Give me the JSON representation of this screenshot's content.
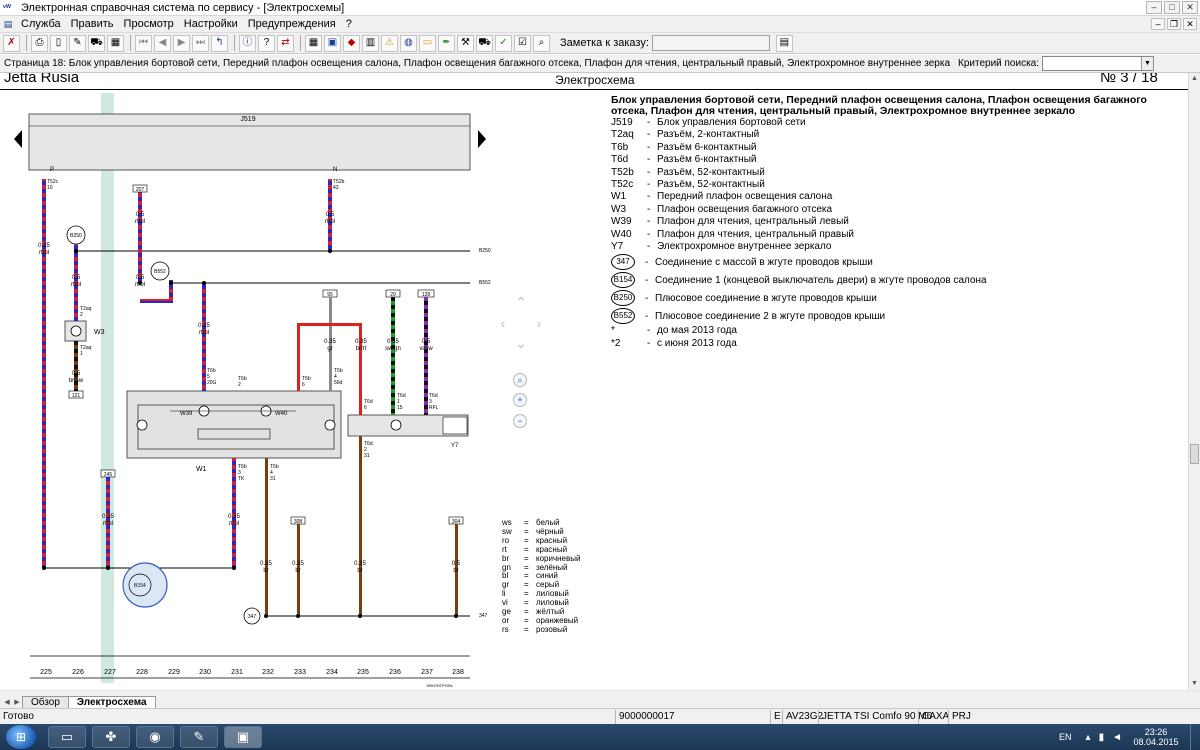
{
  "window": {
    "title": "Электронная справочная система по сервису - [Электросхемы]",
    "app_icon": "app-logo-icon"
  },
  "menu": [
    "Служба",
    "Править",
    "Просмотр",
    "Настройки",
    "Предупреждения",
    "?"
  ],
  "toolbar": {
    "order_label": "Заметка к заказу:",
    "order_value": ""
  },
  "infobar": {
    "text": "Страница 18: Блок управления бортовой сети, Передний плафон освещения салона, Плафон освещения багажного отсека, Плафон для чтения, центральный правый, Электрохромное внутреннее зеркало",
    "search_label": "Критерий поиска:",
    "search_value": ""
  },
  "document": {
    "model": "Jetta Rusia",
    "doc_type": "Электросхема",
    "page_no": "№  3 / 18",
    "legend_title": "Блок управления бортовой сети, Передний плафон освещения салона, Плафон освещения багажного отсека, Плафон для чтения, центральный правый, Электрохромное внутреннее зеркало",
    "legend": [
      {
        "code": "J519",
        "desc": "Блок управления бортовой сети"
      },
      {
        "code": "T2aq",
        "desc": "Разъём, 2-контактный"
      },
      {
        "code": "T6b",
        "desc": "Разъём 6-контактный"
      },
      {
        "code": "T6d",
        "desc": "Разъём 6-контактный"
      },
      {
        "code": "T52b",
        "desc": "Разъём, 52-контактный"
      },
      {
        "code": "T52c",
        "desc": "Разъём, 52-контактный"
      },
      {
        "code": "W1",
        "desc": "Передний плафон освещения салона"
      },
      {
        "code": "W3",
        "desc": "Плафон освещения багажного отсека"
      },
      {
        "code": "W39",
        "desc": "Плафон для чтения, центральный левый"
      },
      {
        "code": "W40",
        "desc": "Плафон для чтения, центральный правый"
      },
      {
        "code": "Y7",
        "desc": "Электрохромное внутреннее зеркало"
      }
    ],
    "legend_circles": [
      {
        "code": "347",
        "desc": "Соединение с массой в жгуте проводов крыши"
      },
      {
        "code": "B154",
        "desc": "Соединение 1 (концевой выключатель двери) в жгуте проводов салона"
      },
      {
        "code": "B250",
        "desc": "Плюсовое соединение в жгуте проводов крыши"
      },
      {
        "code": "B552",
        "desc": "Плюсовое соединение 2 в жгуте проводов крыши"
      }
    ],
    "legend_notes": [
      {
        "code": "*",
        "desc": "до мая 2013 года"
      },
      {
        "code": "*2",
        "desc": "с июня 2013 года"
      }
    ],
    "color_codes": [
      {
        "code": "ws",
        "name": "белый"
      },
      {
        "code": "sw",
        "name": "чёрный"
      },
      {
        "code": "ro",
        "name": "красный"
      },
      {
        "code": "rt",
        "name": "красный"
      },
      {
        "code": "br",
        "name": "коричневый"
      },
      {
        "code": "gn",
        "name": "зелёный"
      },
      {
        "code": "bl",
        "name": "синий"
      },
      {
        "code": "gr",
        "name": "серый"
      },
      {
        "code": "li",
        "name": "лиловый"
      },
      {
        "code": "vi",
        "name": "лиловый"
      },
      {
        "code": "ge",
        "name": "жёлтый"
      },
      {
        "code": "or",
        "name": "оранжевый"
      },
      {
        "code": "rs",
        "name": "розовый"
      }
    ],
    "diagram": {
      "j519_label": "J519",
      "w3_label": "W3",
      "w1_label": "W1",
      "w39_label": "W39",
      "w40_label": "W40",
      "y7_label": "Y7",
      "b250_label": "B250",
      "b552_label": "B552",
      "b154_label": "B154",
      "gnd_label": "347",
      "pin_p": "P",
      "pin_n": "N",
      "pin_t52c": "T52c",
      "pin_t52c_no": "10",
      "pin_t52b": "T52b",
      "pin_t52b_no": "43",
      "pin_t2aq_top": "T2aq",
      "pin_t2aq_top_no": "2",
      "pin_t2aq_bot": "T2aq",
      "pin_t2aq_bot_no": "1",
      "pin_t6b_1": "T6b",
      "pin_t6b_1_no": "5",
      "pin_t6b_1_star": "20G",
      "pin_t6b_2": "T6b",
      "pin_t6b_2_no": "2",
      "pin_t6b_3": "T6b",
      "pin_t6b_3_no": "6",
      "pin_t6b_4": "T6b",
      "pin_t6b_4_no": "4",
      "pin_t6b_4_star": "56d",
      "pin_t6b_5": "T6b",
      "pin_t6b_5_no": "3",
      "pin_t6b_5_star": "TK",
      "pin_t6b_6": "T6b",
      "pin_t6b_6_no": "4",
      "pin_t6b_6_star": "31",
      "pin_t6d_1": "T6d",
      "pin_t6d_1_no": "6",
      "pin_t6d_2": "T6d",
      "pin_t6d_2_no": "1",
      "pin_t6d_2_star": "15",
      "pin_t6d_3": "T6d",
      "pin_t6d_3_no": "3",
      "pin_t6d_3_star": "RFL",
      "pin_t6d_4": "T6d",
      "pin_t6d_4_no": "2",
      "pin_t6d_4_star": "31",
      "ref_207": "207",
      "ref_95": "95",
      "ref_29": "29",
      "ref_128": "128",
      "ref_121": "121",
      "ref_245": "245",
      "ref_308": "308",
      "ref_304": "304",
      "w_t52c": "0.35",
      "w_t52c_c": "rt/bl",
      "w_207": "0.5",
      "w_207_c": "rt/bl",
      "w_t52b": "0.5",
      "w_t52b_c": "rt/bl",
      "w_b250": "0.5",
      "w_b250_c": "rt/bl",
      "w_b552": "0.5",
      "w_b552_c": "rt/bl",
      "w_t6b5": "0.35",
      "w_t6b5_c": "rt/bl",
      "w_95": "0.35",
      "w_95_c": "gr",
      "w_red": "0.35",
      "w_red_c": "br/rt",
      "w_29": "0.35",
      "w_29_c": "sw/gn",
      "w_128": "0.5",
      "w_128_c": "vi/sw",
      "w_w3": "0.5",
      "w_w3_c": "br/sw",
      "w_245": "0.35",
      "w_245_c": "rt/bl",
      "w_tk": "0.35",
      "w_tk_c": "rt/bl",
      "w_31": "0.35",
      "w_31_c": "br",
      "w_308": "0.35",
      "w_308_c": "br",
      "w_t6d4": "0.35",
      "w_t6d4_c": "br",
      "w_304": "0.5",
      "w_304_c": "br",
      "bus_b250": "B250",
      "bus_b552": "B552",
      "bus_347": "347",
      "columns": [
        "225",
        "226",
        "227",
        "228",
        "229",
        "230",
        "231",
        "232",
        "233",
        "234",
        "235",
        "236",
        "237",
        "238"
      ],
      "footer_code": "ЭЛКОНТРОЛЬ"
    }
  },
  "tabs": [
    "Обзор",
    "Электросхема"
  ],
  "status": {
    "ready": "Готово",
    "order_no": "9000000017",
    "e": "E",
    "code": "AV23G2",
    "model": "JETTA TSI Comfo 90 M6",
    "engine": "CAXA",
    "gear": "PRJ"
  },
  "taskbar": {
    "lang": "EN",
    "time": "23:26",
    "date": "08.04.2015"
  }
}
